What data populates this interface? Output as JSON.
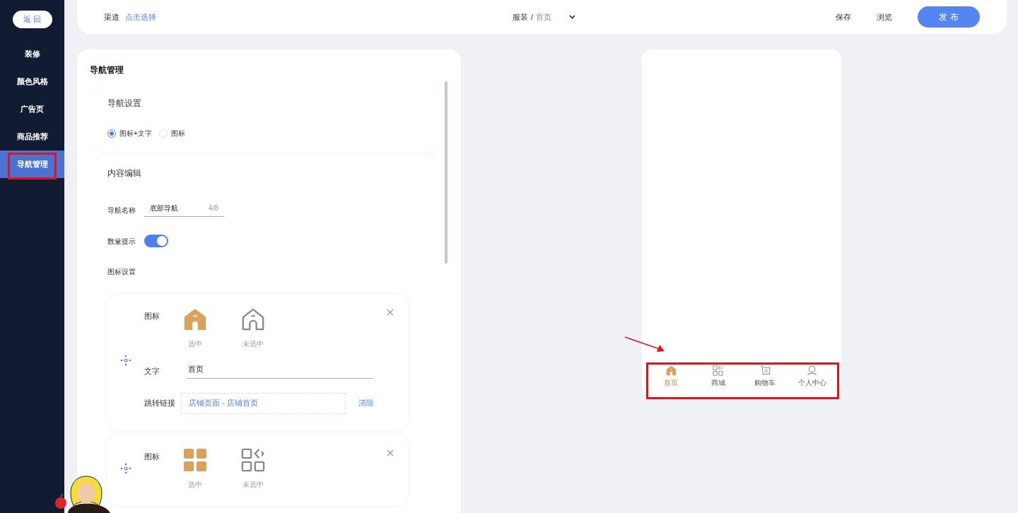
{
  "sidebar": {
    "back_button": "返回",
    "items": [
      {
        "label": "装修",
        "selected": false
      },
      {
        "label": "颜色风格",
        "selected": false
      },
      {
        "label": "广告页",
        "selected": false
      },
      {
        "label": "商品推荐",
        "selected": false
      },
      {
        "label": "导航管理",
        "selected": true
      }
    ]
  },
  "topbar": {
    "channel_label": "渠道",
    "channel_link": "点击选择",
    "breadcrumb": {
      "category": "服装",
      "separator": "/",
      "page": "首页"
    },
    "actions": [
      "保存",
      "浏览"
    ],
    "publish": "发布"
  },
  "panel": {
    "title": "导航管理",
    "nav_settings": {
      "title": "导航设置",
      "options": [
        {
          "label": "图标+文字",
          "selected": true
        },
        {
          "label": "图标",
          "selected": false
        }
      ]
    },
    "content_edit": {
      "title": "内容编辑",
      "name_label": "导航名称",
      "name_value": "底部导航",
      "name_count": "4/8",
      "badge_label": "数量提示",
      "badge_on": true,
      "icon_settings_label": "图标设置",
      "items": [
        {
          "kind": "home",
          "icon_label": "图标",
          "selected_caption": "选中",
          "unselected_caption": "未选中",
          "text_label": "文字",
          "text_value": "首页",
          "link_label": "跳转链接",
          "link_value": "店铺页面 - 店铺首页",
          "clear": "清除"
        },
        {
          "kind": "grid",
          "icon_label": "图标",
          "selected_caption": "选中",
          "unselected_caption": "未选中"
        }
      ]
    }
  },
  "preview": {
    "tabs": [
      {
        "label": "首页",
        "kind": "home",
        "selected": true
      },
      {
        "label": "商城",
        "kind": "grid",
        "selected": false
      },
      {
        "label": "购物车",
        "kind": "cart",
        "selected": false
      },
      {
        "label": "个人中心",
        "kind": "person",
        "selected": false
      }
    ]
  }
}
